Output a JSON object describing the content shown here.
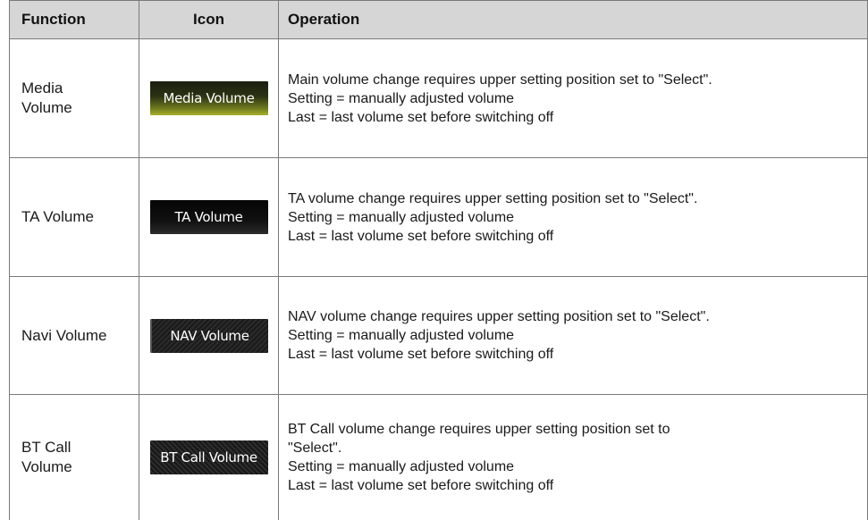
{
  "header": {
    "function": "Function",
    "icon": "Icon",
    "operation": "Operation"
  },
  "rows": [
    {
      "function": "Media\nVolume",
      "function_lines": [
        "Media",
        "Volume"
      ],
      "icon_label": "Media Volume",
      "icon_name": "media-volume-icon",
      "operation": [
        "Main volume change requires upper setting position set to \"Select\".",
        "Setting = manually adjusted volume",
        "Last = last volume set before switching off"
      ]
    },
    {
      "function_lines": [
        "TA Volume"
      ],
      "icon_label": "TA Volume",
      "icon_name": "ta-volume-icon",
      "operation": [
        "TA volume change requires upper setting position set to \"Select\".",
        "Setting = manually adjusted volume",
        "Last = last volume set before switching off"
      ]
    },
    {
      "function_lines": [
        "Navi Volume"
      ],
      "icon_label": "NAV Volume",
      "icon_name": "nav-volume-icon",
      "operation": [
        "NAV volume change requires upper setting position set to \"Select\".",
        "Setting = manually adjusted volume",
        "Last = last volume set before switching off"
      ]
    },
    {
      "function_lines": [
        "BT Call",
        "Volume"
      ],
      "icon_label": "BT Call Volume",
      "icon_name": "bt-call-volume-icon",
      "operation": [
        "BT Call volume change requires upper setting position set to",
        "\"Select\".",
        "Setting = manually adjusted volume",
        "Last = last volume set before switching off"
      ]
    }
  ]
}
